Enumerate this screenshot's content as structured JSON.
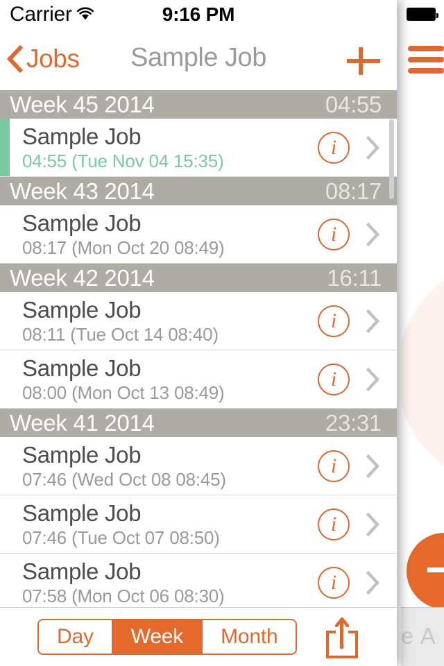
{
  "status_bar": {
    "carrier": "Carrier",
    "wifi_icon": "wifi-icon",
    "time": "9:16 PM",
    "battery_icon": "battery-full-icon"
  },
  "nav_bar": {
    "back_label": "Jobs",
    "back_icon": "chevron-left-icon",
    "title": "Sample Job",
    "add_icon": "plus-icon"
  },
  "sections": [
    {
      "title": "Week 45 2014",
      "total": "04:55",
      "rows": [
        {
          "title": "Sample Job",
          "subtitle": "04:55 (Tue Nov 04 15:35)",
          "active": true,
          "info_icon": "info-circle-icon",
          "disclosure_icon": "chevron-right-icon"
        }
      ]
    },
    {
      "title": "Week 43 2014",
      "total": "08:17",
      "rows": [
        {
          "title": "Sample Job",
          "subtitle": "08:17 (Mon Oct 20 08:49)",
          "active": false,
          "info_icon": "info-circle-icon",
          "disclosure_icon": "chevron-right-icon"
        }
      ]
    },
    {
      "title": "Week 42 2014",
      "total": "16:11",
      "rows": [
        {
          "title": "Sample Job",
          "subtitle": "08:11 (Tue Oct 14 08:40)",
          "active": false,
          "info_icon": "info-circle-icon",
          "disclosure_icon": "chevron-right-icon"
        },
        {
          "title": "Sample Job",
          "subtitle": "08:00 (Mon Oct 13 08:49)",
          "active": false,
          "info_icon": "info-circle-icon",
          "disclosure_icon": "chevron-right-icon"
        }
      ]
    },
    {
      "title": "Week 41 2014",
      "total": "23:31",
      "rows": [
        {
          "title": "Sample Job",
          "subtitle": "07:46 (Wed Oct 08 08:45)",
          "active": false,
          "info_icon": "info-circle-icon",
          "disclosure_icon": "chevron-right-icon"
        },
        {
          "title": "Sample Job",
          "subtitle": "07:46 (Tue Oct 07 08:50)",
          "active": false,
          "info_icon": "info-circle-icon",
          "disclosure_icon": "chevron-right-icon"
        },
        {
          "title": "Sample Job",
          "subtitle": "07:58 (Mon Oct 06 08:30)",
          "active": false,
          "info_icon": "info-circle-icon",
          "disclosure_icon": "chevron-right-icon"
        }
      ]
    }
  ],
  "toolbar": {
    "segments": [
      {
        "label": "Day",
        "selected": false
      },
      {
        "label": "Week",
        "selected": true
      },
      {
        "label": "Month",
        "selected": false
      }
    ],
    "share_icon": "share-icon"
  },
  "right_panel": {
    "menu_icon": "hamburger-menu-icon",
    "fab_icon": "plus-icon",
    "footer_text": "e A"
  },
  "colors": {
    "accent_orange": "#DB6A32",
    "selected_orange": "#E4692A",
    "section_gray": "#AFACA6",
    "active_green": "#7BC9A1",
    "title_gray": "#9B9B9B",
    "row_title": "#4C4C4C",
    "row_subtitle": "#9A9A9A",
    "panel_circle": "#FDF2EE",
    "footer_bg": "#EAEAEA"
  }
}
